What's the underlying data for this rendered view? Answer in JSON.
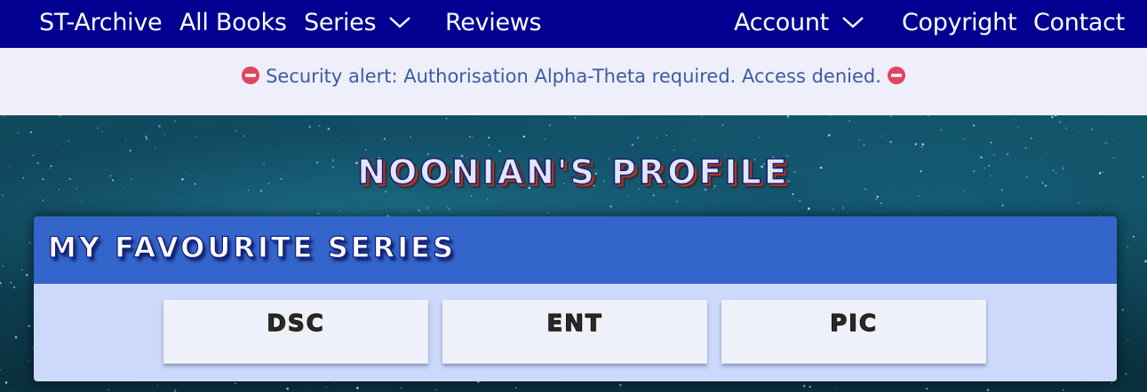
{
  "nav": {
    "brand": "ST-Archive",
    "all_books": "All Books",
    "series": "Series",
    "reviews": "Reviews",
    "account": "Account",
    "copyright": "Copyright",
    "contact": "Contact"
  },
  "alert": {
    "text": "Security alert: Authorisation Alpha-Theta required. Access denied.",
    "icon": "no-entry-icon",
    "icon_color": "#e0455e"
  },
  "profile": {
    "title": "NOONIAN'S PROFILE"
  },
  "favourites": {
    "title": "MY FAVOURITE SERIES",
    "items": [
      {
        "label": "DSC"
      },
      {
        "label": "ENT"
      },
      {
        "label": "PIC"
      }
    ]
  },
  "colors": {
    "nav_bg": "#020090",
    "alert_bg": "#eeeffa",
    "alert_text": "#3d5aa5",
    "panel_header": "#3465cb",
    "panel_body": "#cdd9fb"
  }
}
